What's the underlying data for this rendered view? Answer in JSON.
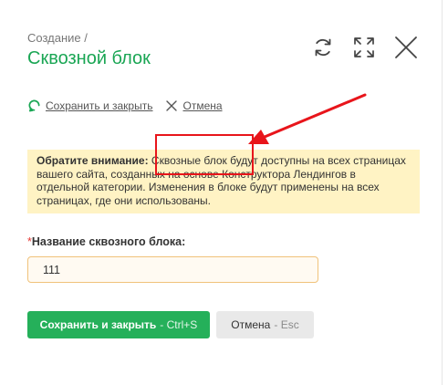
{
  "header": {
    "breadcrumb": "Создание /",
    "title": "Сквозной блок",
    "icons": [
      "refresh-icon",
      "expand-icon",
      "close-icon"
    ]
  },
  "top_actions": {
    "save_close": "Сохранить и закрыть",
    "cancel": "Отмена"
  },
  "notice": {
    "strong": "Обратите внимание:",
    "text": " Сквозные блок будут доступны на всех страницах вашего сайта, созданных на основе Конструктора Лендингов в отдельной категории. Изменения в блоке будут применены на всех страницах, где они использованы."
  },
  "form": {
    "required_mark": "*",
    "label": "Название сквозного блока:",
    "value": "111"
  },
  "buttons": {
    "save_label": "Сохранить и закрыть",
    "save_hint": "- Ctrl+S",
    "cancel_label": "Отмена",
    "cancel_hint": "- Esc"
  },
  "colors": {
    "accent": "#1aa654",
    "button_green": "#25b05a",
    "notice_bg": "#fff3c4",
    "annotation_red": "#e8151b"
  }
}
